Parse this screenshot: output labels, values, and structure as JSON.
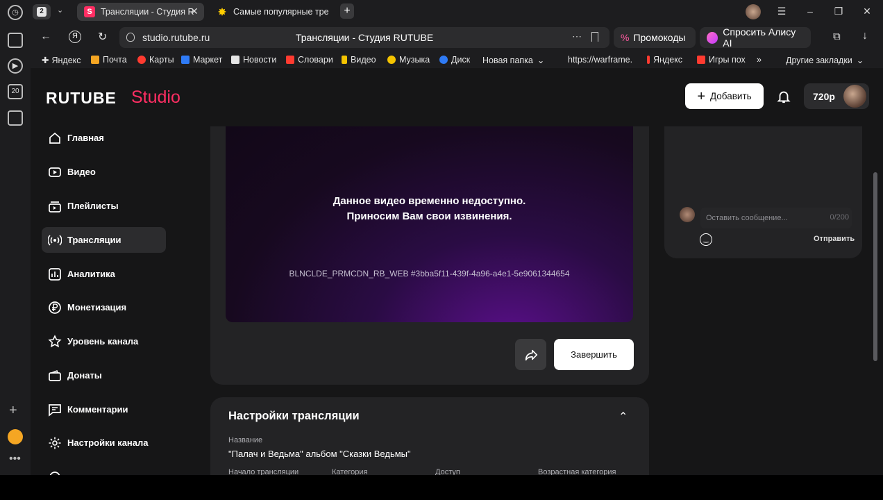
{
  "browser": {
    "tab_count": "2",
    "tabs": [
      {
        "label": "Трансляции - Студия R",
        "favicon": "S"
      },
      {
        "label": "Самые популярные треки"
      }
    ],
    "url": "studio.rutube.ru",
    "page_title": "Трансляции - Студия RUTUBE",
    "promo_label": "Промокоды",
    "alice_label": "Спросить Алису AI",
    "bookmarks": [
      "Яндекс",
      "Почта",
      "Карты",
      "Маркет",
      "Новости",
      "Словари",
      "Видео",
      "Музыка",
      "Диск",
      "Новая папка",
      "https://warframe.",
      "Яндекс",
      "Игры пох",
      "Другие закладки"
    ],
    "side_badge": "20"
  },
  "header": {
    "logo_main": "RUTUBE",
    "logo_studio": "Studio",
    "add_label": "Добавить",
    "quality": "720p"
  },
  "sidebar": {
    "items": [
      {
        "label": "Главная",
        "icon": "home-icon"
      },
      {
        "label": "Видео",
        "icon": "video-icon"
      },
      {
        "label": "Плейлисты",
        "icon": "playlist-icon"
      },
      {
        "label": "Трансляции",
        "icon": "broadcast-icon",
        "active": true
      },
      {
        "label": "Аналитика",
        "icon": "chart-icon"
      },
      {
        "label": "Монетизация",
        "icon": "ruble-icon"
      },
      {
        "label": "Уровень канала",
        "icon": "star-icon"
      },
      {
        "label": "Донаты",
        "icon": "wallet-icon"
      },
      {
        "label": "Комментарии",
        "icon": "comment-icon"
      },
      {
        "label": "Настройки канала",
        "icon": "gear-icon"
      }
    ]
  },
  "player": {
    "message_line1": "Данное видео временно недоступно.",
    "message_line2": "Приносим Вам свои извинения.",
    "error_code": "BLNCLDE_PRMCDN_RB_WEB #3bba5f11-439f-4a96-a4e1-5e9061344654",
    "end_label": "Завершить"
  },
  "chat": {
    "placeholder": "Оставить сообщение...",
    "counter": "0/200",
    "send_label": "Отправить"
  },
  "settings": {
    "title": "Настройки трансляции",
    "name_label": "Название",
    "name_value": "\"Палач и Ведьма\" альбом \"Сказки Ведьмы\"",
    "columns": [
      "Начало трансляции",
      "Категория",
      "Доступ",
      "Возрастная категория"
    ]
  },
  "colors": {
    "accent": "#ff2e63",
    "background": "#161617",
    "card": "#232325"
  }
}
